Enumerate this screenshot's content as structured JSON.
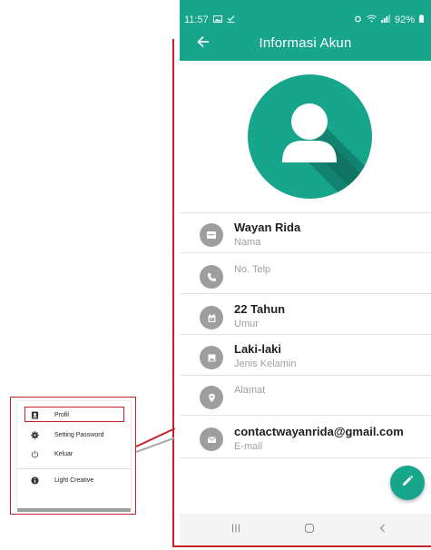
{
  "status_bar": {
    "time": "11:57",
    "battery": "92%"
  },
  "app_bar": {
    "title": "Informasi Akun",
    "back_icon": "arrow-left-icon"
  },
  "avatar": {
    "icon": "person-icon",
    "color": "#17a58b"
  },
  "info": {
    "name": {
      "value": "Wayan Rida",
      "label": "Nama",
      "icon": "id-card-icon"
    },
    "phone": {
      "label": "No. Telp",
      "icon": "phone-icon"
    },
    "age": {
      "value": "22 Tahun",
      "label": "Umur",
      "icon": "calendar-icon"
    },
    "gender": {
      "value": "Laki-laki",
      "label": "Jenis Kelamin",
      "icon": "image-icon"
    },
    "address": {
      "label": "Alamat",
      "icon": "location-pin-icon"
    },
    "email": {
      "value": "contactwayanrida@gmail.com",
      "label": "E-mail",
      "icon": "mail-icon"
    }
  },
  "fab": {
    "icon": "pencil-icon"
  },
  "nav_bar": {
    "recents_icon": "recents-icon",
    "home_icon": "home-icon",
    "back_icon": "chevron-left-icon"
  },
  "drawer_menu": {
    "items": [
      {
        "label": "Profil",
        "icon": "profile-card-icon"
      },
      {
        "label": "Setting Password",
        "icon": "gear-icon"
      },
      {
        "label": "Keluar",
        "icon": "power-icon"
      },
      {
        "label": "Light Creative",
        "icon": "info-icon"
      }
    ]
  },
  "colors": {
    "primary": "#17a58b",
    "annotation": "#c8202a",
    "icon_gray": "#9e9e9e"
  }
}
